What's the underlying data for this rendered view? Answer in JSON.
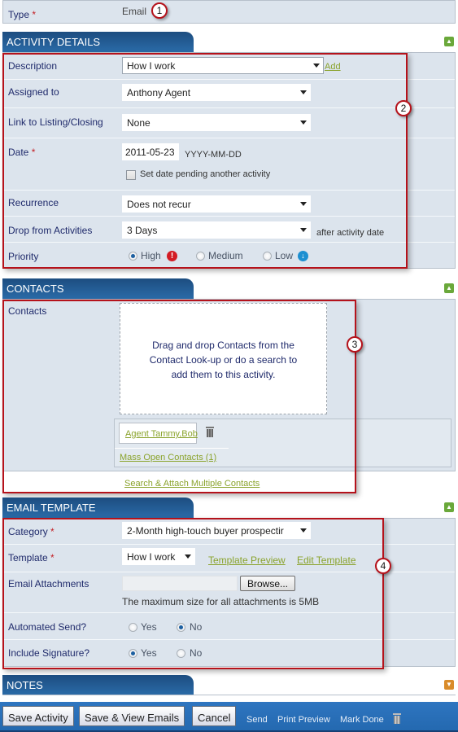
{
  "type_row": {
    "label": "Type",
    "required_marker": "*",
    "value": "Email",
    "callout": "1"
  },
  "activity_details": {
    "title": "ACTIVITY DETAILS",
    "collapse_icon": "chevron-up-icon",
    "callout": "2",
    "description": {
      "label": "Description",
      "value": "How I work",
      "add_link": "Add"
    },
    "assigned_to": {
      "label": "Assigned to",
      "value": "Anthony Agent"
    },
    "link_to_listing": {
      "label": "Link to Listing/Closing",
      "value": "None"
    },
    "date": {
      "label": "Date",
      "required_marker": "*",
      "value": "2011-05-23",
      "format_hint": "YYYY-MM-DD",
      "pending_checkbox_label": "Set date pending another activity",
      "pending_checked": false
    },
    "recurrence": {
      "label": "Recurrence",
      "value": "Does not recur"
    },
    "drop_from_activities": {
      "label": "Drop from Activities",
      "value": "3 Days",
      "suffix": "after activity date"
    },
    "priority": {
      "label": "Priority",
      "options": [
        {
          "label": "High",
          "selected": true,
          "icon": "exclamation-icon"
        },
        {
          "label": "Medium",
          "selected": false
        },
        {
          "label": "Low",
          "selected": false,
          "icon": "arrow-down-icon"
        }
      ]
    }
  },
  "contacts": {
    "title": "CONTACTS",
    "collapse_icon": "chevron-up-icon",
    "callout": "3",
    "label": "Contacts",
    "dropzone_lines": [
      "Drag and drop Contacts from the",
      "Contact Look-up or do a search to",
      "add them to this activity."
    ],
    "attached": [
      {
        "name": "Agent Tammy,Bob"
      }
    ],
    "mass_open_link": "Mass Open Contacts (1)",
    "search_attach_link": "Search & Attach Multiple Contacts"
  },
  "email_template": {
    "title": "EMAIL TEMPLATE",
    "collapse_icon": "chevron-up-icon",
    "callout": "4",
    "category": {
      "label": "Category",
      "required_marker": "*",
      "value": "2-Month high-touch buyer prospectir"
    },
    "template": {
      "label": "Template",
      "required_marker": "*",
      "value": "How I work",
      "preview_link": "Template Preview",
      "edit_link": "Edit Template"
    },
    "attachments": {
      "label": "Email Attachments",
      "file_value": "",
      "browse_label": "Browse...",
      "note": "The maximum size for all attachments is 5MB"
    },
    "automated_send": {
      "label": "Automated Send?",
      "options": [
        {
          "label": "Yes",
          "selected": false
        },
        {
          "label": "No",
          "selected": true
        }
      ]
    },
    "include_signature": {
      "label": "Include Signature?",
      "options": [
        {
          "label": "Yes",
          "selected": true
        },
        {
          "label": "No",
          "selected": false
        }
      ]
    }
  },
  "notes": {
    "title": "NOTES",
    "expand_icon": "chevron-down-icon"
  },
  "footer": {
    "save_activity": "Save Activity",
    "save_view_emails": "Save & View Emails",
    "cancel": "Cancel",
    "send": "Send",
    "print_preview": "Print Preview",
    "mark_done": "Mark Done"
  },
  "colors": {
    "header_blue": "#1d4d80",
    "panel_bg": "#dce4ed",
    "link_green": "#8aa32c",
    "callout_red": "#b5121b",
    "footer_blue": "#2e75c0",
    "label_navy": "#1f2a6b"
  }
}
